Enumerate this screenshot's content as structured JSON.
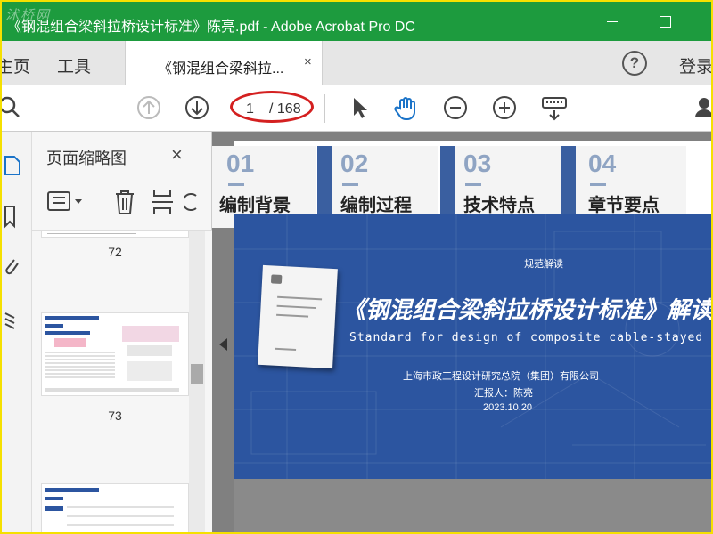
{
  "window": {
    "watermark": "沭桥网",
    "title": "《钢混组合梁斜拉桥设计标准》陈亮.pdf - Adobe Acrobat Pro DC"
  },
  "tabs": {
    "home": "主页",
    "tools": "工具",
    "document": "《钢混组合梁斜拉...",
    "close": "×",
    "help": "?",
    "login": "登录"
  },
  "toolbar": {
    "current_page": "1",
    "total_pages": "/ 168"
  },
  "thumbnails": {
    "title": "页面缩略图",
    "close": "×",
    "pages": [
      "72",
      "73"
    ]
  },
  "slide": {
    "sections": [
      {
        "num": "01",
        "label": "编制背景"
      },
      {
        "num": "02",
        "label": "编制过程"
      },
      {
        "num": "03",
        "label": "技术特点"
      },
      {
        "num": "04",
        "label": "章节要点"
      }
    ],
    "tag": "规范解读",
    "title": "《钢混组合梁斜拉桥设计标准》解读",
    "title_en": "Standard for design of composite cable-stayed bridge",
    "institute": "上海市政工程设计研究总院（集团）有限公司",
    "reporter": "汇报人：陈亮",
    "date": "2023.10.20"
  },
  "colors": {
    "titlebar": "#1d9b3e",
    "banner": "#2c55a0",
    "highlight": "#d42020",
    "border": "#f5e000"
  }
}
